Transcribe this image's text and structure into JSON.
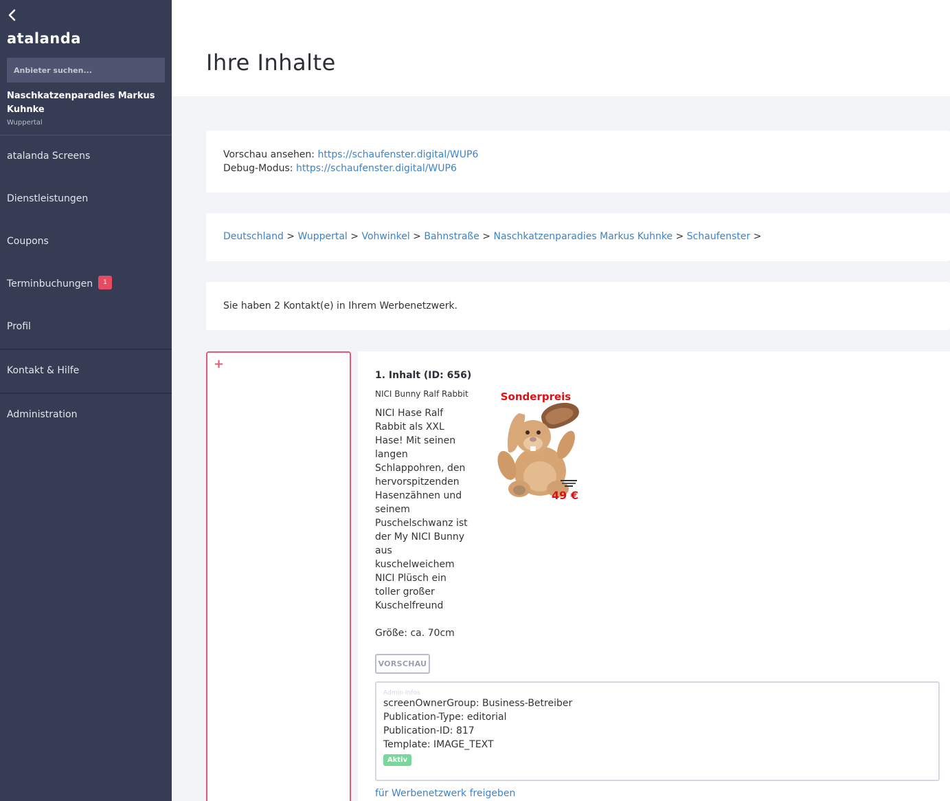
{
  "sidebar": {
    "brand": "atalanda",
    "search_placeholder": "Anbieter suchen...",
    "shop_name": "Naschkatzenparadies Markus Kuhnke",
    "shop_city": "Wuppertal",
    "items": [
      {
        "label": "atalanda Screens"
      },
      {
        "label": "Dienstleistungen"
      },
      {
        "label": "Coupons"
      },
      {
        "label": "Terminbuchungen",
        "badge": "1"
      },
      {
        "label": "Profil"
      },
      {
        "label": "Kontakt & Hilfe"
      },
      {
        "label": "Administration"
      }
    ]
  },
  "header": {
    "title": "Ihre Inhalte"
  },
  "links": {
    "preview_label": "Vorschau ansehen: ",
    "preview_url": "https://schaufenster.digital/WUP6",
    "debug_label": "Debug-Modus: ",
    "debug_url": "https://schaufenster.digital/WUP6"
  },
  "breadcrumb": [
    "Deutschland",
    "Wuppertal",
    "Vohwinkel",
    "Bahnstraße",
    "Naschkatzenparadies Markus Kuhnke",
    "Schaufenster"
  ],
  "contacts_text": "Sie haben 2 Kontakt(e) in Ihrem Werbenetzwerk.",
  "content": {
    "title": "1. Inhalt (ID: 656)",
    "subtitle": "NICI Bunny Ralf Rabbit",
    "description": "NICI Hase Ralf Rabbit als XXL Hase! Mit seinen langen Schlappohren, den hervorspitzenden Hasenzähnen und seinem Puschelschwanz ist der My NICI Bunny aus kuschelweichem NICI Plüsch ein toller großer Kuschelfreund\n\nGröße: ca. 70cm",
    "image_heading": "Sonderpreis",
    "image_price": "49 €",
    "preview_button": "VORSCHAU",
    "admin": {
      "label": "Admin-Infos",
      "owner_group": "screenOwnerGroup: Business-Betreiber",
      "pub_type": "Publication-Type: editorial",
      "pub_id": "Publication-ID: 817",
      "template": "Template: IMAGE_TEXT",
      "status": "Aktiv"
    },
    "share_link": "für Werbenetzwerk freigeben"
  },
  "colors": {
    "sidebar": "#363c54",
    "accent": "#e35a75",
    "link": "#3e83c5",
    "status": "#7ad79c"
  }
}
